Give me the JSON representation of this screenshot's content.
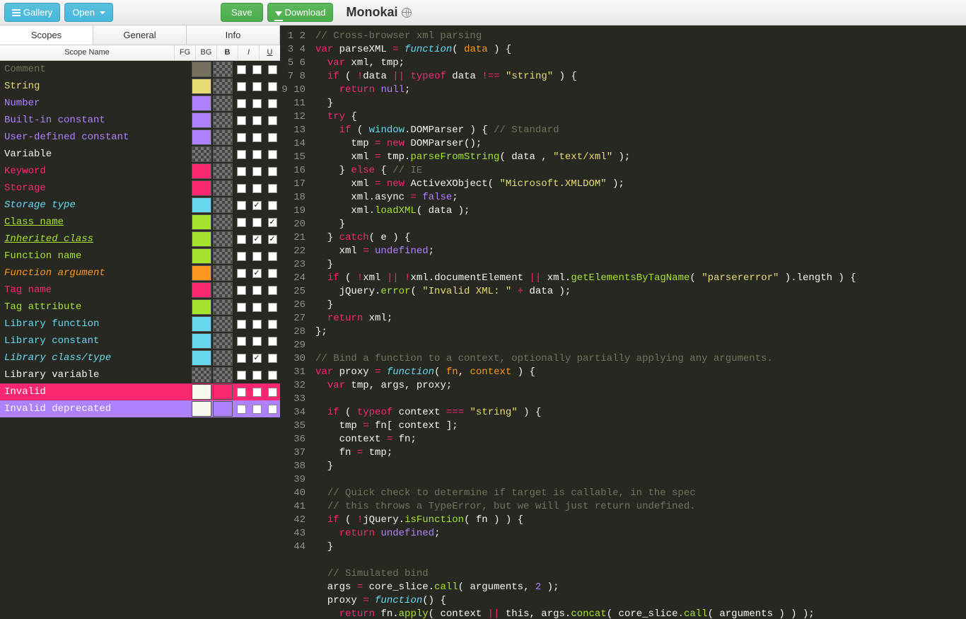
{
  "toolbar": {
    "gallery_label": "Gallery",
    "open_label": "Open",
    "save_label": "Save",
    "download_label": "Download"
  },
  "theme_name": "Monokai",
  "tabs": [
    "Scopes",
    "General",
    "Info"
  ],
  "active_tab": "Scopes",
  "headers": {
    "name": "Scope Name",
    "fg": "FG",
    "bg": "BG",
    "b": "B",
    "i": "I",
    "u": "U"
  },
  "scopes": [
    {
      "name": "Comment",
      "fg": "#75715e",
      "bg": null,
      "b": false,
      "i": false,
      "u": false,
      "color": "#75715e"
    },
    {
      "name": "String",
      "fg": "#e6db74",
      "bg": null,
      "b": false,
      "i": false,
      "u": false,
      "color": "#e6db74"
    },
    {
      "name": "Number",
      "fg": "#ae81ff",
      "bg": null,
      "b": false,
      "i": false,
      "u": false,
      "color": "#ae81ff"
    },
    {
      "name": "Built-in constant",
      "fg": "#ae81ff",
      "bg": null,
      "b": false,
      "i": false,
      "u": false,
      "color": "#ae81ff"
    },
    {
      "name": "User-defined constant",
      "fg": "#ae81ff",
      "bg": null,
      "b": false,
      "i": false,
      "u": false,
      "color": "#ae81ff"
    },
    {
      "name": "Variable",
      "fg": null,
      "bg": null,
      "b": false,
      "i": false,
      "u": false,
      "color": "#f8f8f2"
    },
    {
      "name": "Keyword",
      "fg": "#f92672",
      "bg": null,
      "b": false,
      "i": false,
      "u": false,
      "color": "#f92672"
    },
    {
      "name": "Storage",
      "fg": "#f92672",
      "bg": null,
      "b": false,
      "i": false,
      "u": false,
      "color": "#f92672"
    },
    {
      "name": "Storage type",
      "fg": "#66d9ef",
      "bg": null,
      "b": false,
      "i": true,
      "u": false,
      "color": "#66d9ef",
      "italic": true
    },
    {
      "name": "Class name",
      "fg": "#a6e22e",
      "bg": null,
      "b": false,
      "i": false,
      "u": true,
      "color": "#a6e22e",
      "underline": true
    },
    {
      "name": "Inherited class",
      "fg": "#a6e22e",
      "bg": null,
      "b": false,
      "i": true,
      "u": true,
      "color": "#a6e22e",
      "italic": true,
      "underline": true
    },
    {
      "name": "Function name",
      "fg": "#a6e22e",
      "bg": null,
      "b": false,
      "i": false,
      "u": false,
      "color": "#a6e22e"
    },
    {
      "name": "Function argument",
      "fg": "#fd971f",
      "bg": null,
      "b": false,
      "i": true,
      "u": false,
      "color": "#fd971f",
      "italic": true
    },
    {
      "name": "Tag name",
      "fg": "#f92672",
      "bg": null,
      "b": false,
      "i": false,
      "u": false,
      "color": "#f92672"
    },
    {
      "name": "Tag attribute",
      "fg": "#a6e22e",
      "bg": null,
      "b": false,
      "i": false,
      "u": false,
      "color": "#a6e22e"
    },
    {
      "name": "Library function",
      "fg": "#66d9ef",
      "bg": null,
      "b": false,
      "i": false,
      "u": false,
      "color": "#66d9ef"
    },
    {
      "name": "Library constant",
      "fg": "#66d9ef",
      "bg": null,
      "b": false,
      "i": false,
      "u": false,
      "color": "#66d9ef"
    },
    {
      "name": "Library class/type",
      "fg": "#66d9ef",
      "bg": null,
      "b": false,
      "i": true,
      "u": false,
      "color": "#66d9ef",
      "italic": true
    },
    {
      "name": "Library variable",
      "fg": null,
      "bg": null,
      "b": false,
      "i": false,
      "u": false,
      "color": "#f8f8f2"
    },
    {
      "name": "Invalid",
      "fg": "#f8f8f0",
      "bg": "#f92672",
      "b": false,
      "i": false,
      "u": false,
      "color": "#f8f8f0",
      "row_bg": "#f92672"
    },
    {
      "name": "Invalid deprecated",
      "fg": "#f8f8f0",
      "bg": "#ae81ff",
      "b": false,
      "i": false,
      "u": false,
      "color": "#f8f8f0",
      "row_bg": "#ae81ff"
    }
  ],
  "code": {
    "start_line": 1,
    "lines": [
      [
        {
          "c": "cm",
          "t": "// Cross-browser xml parsing"
        }
      ],
      [
        {
          "c": "kw",
          "t": "var"
        },
        {
          "t": " parseXML "
        },
        {
          "c": "op",
          "t": "="
        },
        {
          "t": " "
        },
        {
          "c": "st",
          "t": "function"
        },
        {
          "t": "( "
        },
        {
          "c": "var",
          "t": "data"
        },
        {
          "t": " ) {"
        }
      ],
      [
        {
          "t": "  "
        },
        {
          "c": "kw",
          "t": "var"
        },
        {
          "t": " xml, tmp;"
        }
      ],
      [
        {
          "t": "  "
        },
        {
          "c": "kw",
          "t": "if"
        },
        {
          "t": " ( "
        },
        {
          "c": "op",
          "t": "!"
        },
        {
          "t": "data "
        },
        {
          "c": "op",
          "t": "||"
        },
        {
          "t": " "
        },
        {
          "c": "kw",
          "t": "typeof"
        },
        {
          "t": " data "
        },
        {
          "c": "op",
          "t": "!=="
        },
        {
          "t": " "
        },
        {
          "c": "str",
          "t": "\"string\""
        },
        {
          "t": " ) {"
        }
      ],
      [
        {
          "t": "    "
        },
        {
          "c": "kw",
          "t": "return"
        },
        {
          "t": " "
        },
        {
          "c": "num",
          "t": "null"
        },
        {
          "t": ";"
        }
      ],
      [
        {
          "t": "  }"
        }
      ],
      [
        {
          "t": "  "
        },
        {
          "c": "kw",
          "t": "try"
        },
        {
          "t": " {"
        }
      ],
      [
        {
          "t": "    "
        },
        {
          "c": "kw",
          "t": "if"
        },
        {
          "t": " ( "
        },
        {
          "c": "obj",
          "t": "window"
        },
        {
          "t": ".DOMParser ) { "
        },
        {
          "c": "cm",
          "t": "// Standard"
        }
      ],
      [
        {
          "t": "      tmp "
        },
        {
          "c": "op",
          "t": "="
        },
        {
          "t": " "
        },
        {
          "c": "kw",
          "t": "new"
        },
        {
          "t": " DOMParser();"
        }
      ],
      [
        {
          "t": "      xml "
        },
        {
          "c": "op",
          "t": "="
        },
        {
          "t": " tmp."
        },
        {
          "c": "fn",
          "t": "parseFromString"
        },
        {
          "t": "( data , "
        },
        {
          "c": "str",
          "t": "\"text/xml\""
        },
        {
          "t": " );"
        }
      ],
      [
        {
          "t": "    } "
        },
        {
          "c": "kw",
          "t": "else"
        },
        {
          "t": " { "
        },
        {
          "c": "cm",
          "t": "// IE"
        }
      ],
      [
        {
          "t": "      xml "
        },
        {
          "c": "op",
          "t": "="
        },
        {
          "t": " "
        },
        {
          "c": "kw",
          "t": "new"
        },
        {
          "t": " ActiveXObject( "
        },
        {
          "c": "str",
          "t": "\"Microsoft.XMLDOM\""
        },
        {
          "t": " );"
        }
      ],
      [
        {
          "t": "      xml.async "
        },
        {
          "c": "op",
          "t": "="
        },
        {
          "t": " "
        },
        {
          "c": "num",
          "t": "false"
        },
        {
          "t": ";"
        }
      ],
      [
        {
          "t": "      xml."
        },
        {
          "c": "fn",
          "t": "loadXML"
        },
        {
          "t": "( data );"
        }
      ],
      [
        {
          "t": "    }"
        }
      ],
      [
        {
          "t": "  } "
        },
        {
          "c": "kw",
          "t": "catch"
        },
        {
          "t": "( e ) {"
        }
      ],
      [
        {
          "t": "    xml "
        },
        {
          "c": "op",
          "t": "="
        },
        {
          "t": " "
        },
        {
          "c": "num",
          "t": "undefined"
        },
        {
          "t": ";"
        }
      ],
      [
        {
          "t": "  }"
        }
      ],
      [
        {
          "t": "  "
        },
        {
          "c": "kw",
          "t": "if"
        },
        {
          "t": " ( "
        },
        {
          "c": "op",
          "t": "!"
        },
        {
          "t": "xml "
        },
        {
          "c": "op",
          "t": "||"
        },
        {
          "t": " "
        },
        {
          "c": "op",
          "t": "!"
        },
        {
          "t": "xml.documentElement "
        },
        {
          "c": "op",
          "t": "||"
        },
        {
          "t": " xml."
        },
        {
          "c": "fn",
          "t": "getElementsByTagName"
        },
        {
          "t": "( "
        },
        {
          "c": "str",
          "t": "\"parsererror\""
        },
        {
          "t": " ).length ) {"
        }
      ],
      [
        {
          "t": "    jQuery."
        },
        {
          "c": "fn",
          "t": "error"
        },
        {
          "t": "( "
        },
        {
          "c": "str",
          "t": "\"Invalid XML: \""
        },
        {
          "t": " "
        },
        {
          "c": "op",
          "t": "+"
        },
        {
          "t": " data );"
        }
      ],
      [
        {
          "t": "  }"
        }
      ],
      [
        {
          "t": "  "
        },
        {
          "c": "kw",
          "t": "return"
        },
        {
          "t": " xml;"
        }
      ],
      [
        {
          "t": "};"
        }
      ],
      [
        {
          "t": ""
        }
      ],
      [
        {
          "c": "cm",
          "t": "// Bind a function to a context, optionally partially applying any arguments."
        }
      ],
      [
        {
          "c": "kw",
          "t": "var"
        },
        {
          "t": " proxy "
        },
        {
          "c": "op",
          "t": "="
        },
        {
          "t": " "
        },
        {
          "c": "st",
          "t": "function"
        },
        {
          "t": "( "
        },
        {
          "c": "var",
          "t": "fn"
        },
        {
          "t": ", "
        },
        {
          "c": "var",
          "t": "context"
        },
        {
          "t": " ) {"
        }
      ],
      [
        {
          "t": "  "
        },
        {
          "c": "kw",
          "t": "var"
        },
        {
          "t": " tmp, args, proxy;"
        }
      ],
      [
        {
          "t": ""
        }
      ],
      [
        {
          "t": "  "
        },
        {
          "c": "kw",
          "t": "if"
        },
        {
          "t": " ( "
        },
        {
          "c": "kw",
          "t": "typeof"
        },
        {
          "t": " context "
        },
        {
          "c": "op",
          "t": "==="
        },
        {
          "t": " "
        },
        {
          "c": "str",
          "t": "\"string\""
        },
        {
          "t": " ) {"
        }
      ],
      [
        {
          "t": "    tmp "
        },
        {
          "c": "op",
          "t": "="
        },
        {
          "t": " fn[ context ];"
        }
      ],
      [
        {
          "t": "    context "
        },
        {
          "c": "op",
          "t": "="
        },
        {
          "t": " fn;"
        }
      ],
      [
        {
          "t": "    fn "
        },
        {
          "c": "op",
          "t": "="
        },
        {
          "t": " tmp;"
        }
      ],
      [
        {
          "t": "  }"
        }
      ],
      [
        {
          "t": ""
        }
      ],
      [
        {
          "t": "  "
        },
        {
          "c": "cm",
          "t": "// Quick check to determine if target is callable, in the spec"
        }
      ],
      [
        {
          "t": "  "
        },
        {
          "c": "cm",
          "t": "// this throws a TypeError, but we will just return undefined."
        }
      ],
      [
        {
          "t": "  "
        },
        {
          "c": "kw",
          "t": "if"
        },
        {
          "t": " ( "
        },
        {
          "c": "op",
          "t": "!"
        },
        {
          "t": "jQuery."
        },
        {
          "c": "fn",
          "t": "isFunction"
        },
        {
          "t": "( fn ) ) {"
        }
      ],
      [
        {
          "t": "    "
        },
        {
          "c": "kw",
          "t": "return"
        },
        {
          "t": " "
        },
        {
          "c": "num",
          "t": "undefined"
        },
        {
          "t": ";"
        }
      ],
      [
        {
          "t": "  }"
        }
      ],
      [
        {
          "t": ""
        }
      ],
      [
        {
          "t": "  "
        },
        {
          "c": "cm",
          "t": "// Simulated bind"
        }
      ],
      [
        {
          "t": "  args "
        },
        {
          "c": "op",
          "t": "="
        },
        {
          "t": " core_slice."
        },
        {
          "c": "fn",
          "t": "call"
        },
        {
          "t": "( arguments, "
        },
        {
          "c": "num",
          "t": "2"
        },
        {
          "t": " );"
        }
      ],
      [
        {
          "t": "  proxy "
        },
        {
          "c": "op",
          "t": "="
        },
        {
          "t": " "
        },
        {
          "c": "st",
          "t": "function"
        },
        {
          "t": "() {"
        }
      ],
      [
        {
          "t": "    "
        },
        {
          "c": "kw",
          "t": "return"
        },
        {
          "t": " fn."
        },
        {
          "c": "fn",
          "t": "apply"
        },
        {
          "t": "( context "
        },
        {
          "c": "op",
          "t": "||"
        },
        {
          "t": " this, args."
        },
        {
          "c": "fn",
          "t": "concat"
        },
        {
          "t": "( core_slice."
        },
        {
          "c": "fn",
          "t": "call"
        },
        {
          "t": "( arguments ) ) );"
        }
      ]
    ]
  }
}
